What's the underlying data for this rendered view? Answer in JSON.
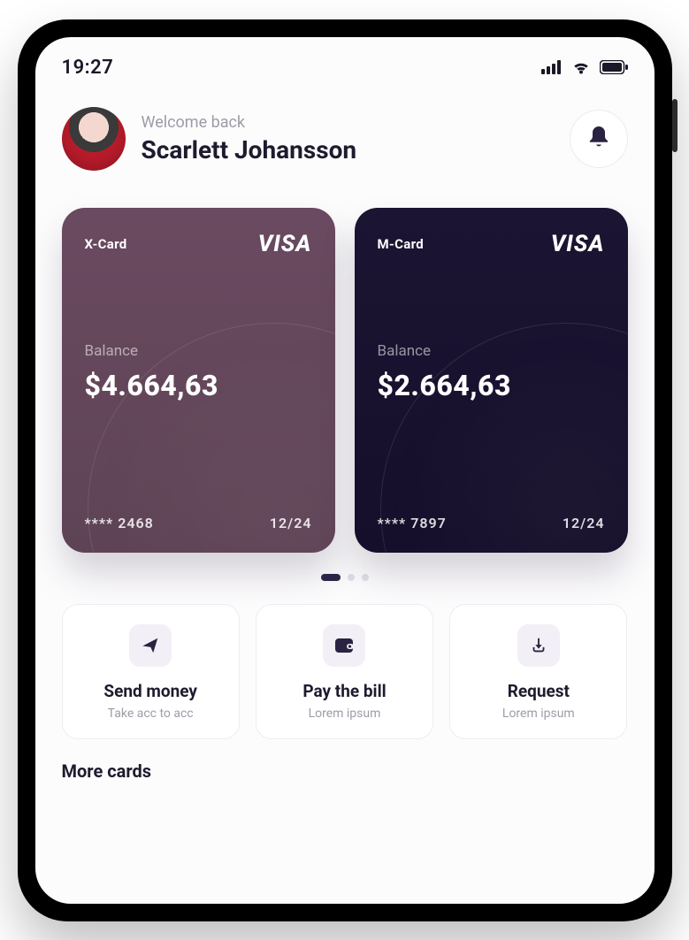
{
  "status": {
    "time": "19:27",
    "icons": {
      "signal": "signal-icon",
      "wifi": "wifi-icon",
      "battery": "battery-icon"
    }
  },
  "header": {
    "avatar": "user-avatar",
    "welcome": "Welcome back",
    "name": "Scarlett Johansson",
    "bell_icon": "bell-icon"
  },
  "cards": [
    {
      "theme": "purple",
      "name": "X-Card",
      "brand": "VISA",
      "balance_label": "Balance",
      "balance": "$4.664,63",
      "masked": "****  2468",
      "expiry": "12/24"
    },
    {
      "theme": "dark",
      "name": "M-Card",
      "brand": "VISA",
      "balance_label": "Balance",
      "balance": "$2.664,63",
      "masked": "****  7897",
      "expiry": "12/24"
    }
  ],
  "carousel": {
    "active_index": 0,
    "count": 3
  },
  "actions": [
    {
      "icon": "paper-plane-icon",
      "title": "Send money",
      "subtitle": "Take acc to acc"
    },
    {
      "icon": "wallet-icon",
      "title": "Pay the bill",
      "subtitle": "Lorem ipsum"
    },
    {
      "icon": "download-icon",
      "title": "Request",
      "subtitle": "Lorem ipsum"
    }
  ],
  "more_cards_label": "More cards"
}
